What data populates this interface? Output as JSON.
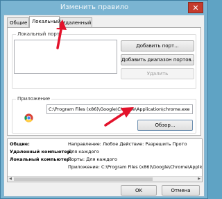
{
  "window": {
    "title": "Изменить правило",
    "close_glyph": "✕"
  },
  "tabs": [
    {
      "label": "Общие"
    },
    {
      "label": "Локальный"
    },
    {
      "label": "Удаленный"
    }
  ],
  "local_ports": {
    "group_label": "Локальный порт",
    "add_button": "Добавить порт...",
    "add_range_button": "Добавить диапазон портов...",
    "remove_button": "Удалить"
  },
  "application": {
    "group_label": "Приложение",
    "path": "C:\\Program Files (x86)\\Google\\Chrome\\Application\\chrome.exe",
    "browse_button": "Обзор..."
  },
  "summary": {
    "rows": [
      {
        "label": "Общие:",
        "value": "Направление: Любое  Действие: Разрешить  Прото"
      },
      {
        "label": "Удаленный компьютер:",
        "value": "Для каждого"
      },
      {
        "label": "Локальный компьютер:",
        "value": "Порты: Для каждого"
      },
      {
        "label": "",
        "value": "Приложение: C:\\Program Files (x86)\\Google\\Chrome\\Application"
      }
    ],
    "scroll_left": "◀",
    "scroll_right": "▶"
  },
  "footer": {
    "ok": "OK",
    "cancel": "Отмена"
  },
  "colors": {
    "window_frame": "#7ab4d2",
    "annotation_arrow": "#e3122b"
  },
  "icons": [
    "chrome-icon",
    "close-icon",
    "red-arrow-annotation"
  ]
}
